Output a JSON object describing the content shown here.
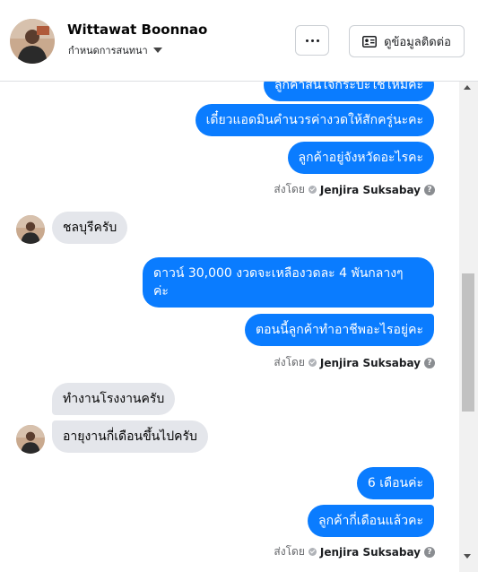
{
  "header": {
    "name": "Wittawat Boonnao",
    "subtitle": "กำหนดการสนทนา",
    "contact_button": "ดูข้อมูลติดต่อ"
  },
  "messages": {
    "m0": "ลูกค้าสนใจกระบะใช้ไหมคะ",
    "m1": "เดี๋ยวแอดมินคำนวรค่างวดให้สักครู่นะคะ",
    "m2": "ลูกค้าอยู่จังหวัดอะไรคะ",
    "m3": "ชลบุรีครับ",
    "m4_line1": "ดาวน์ 30,000 งวดจะเหลืองวดละ 4 พันกลางๆ",
    "m4_line2": "ค่ะ",
    "m5": "ตอนนี้ลูกค้าทำอาชีพอะไรอยู่คะ",
    "m6": "ทำงานโรงงานครับ",
    "m7": "อายุงานกี่เดือนขึ้นไปครับ",
    "m8": "6 เดือนค่ะ",
    "m9": "ลูกค้ากี่เดือนแล้วคะ"
  },
  "sent_by": {
    "prefix": "ส่งโดย",
    "agent": "Jenjira Suksabay"
  },
  "colors": {
    "outgoing": "#0a7cff",
    "incoming": "#e4e6eb"
  }
}
